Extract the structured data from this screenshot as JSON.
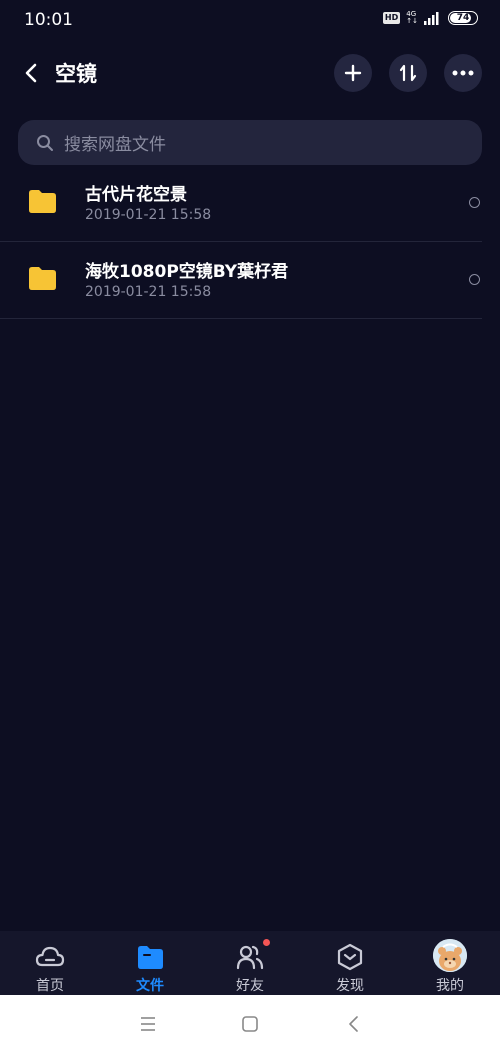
{
  "status_bar": {
    "time": "10:01",
    "hd": "HD",
    "network_top": "4G",
    "network_bottom": "↑↓",
    "battery": "74"
  },
  "header": {
    "title": "空镜",
    "buttons": [
      "back-icon",
      "plus-icon",
      "sort-icon",
      "more-icon"
    ]
  },
  "search": {
    "placeholder": "搜索网盘文件"
  },
  "files": [
    {
      "name": "古代片花空景",
      "date": "2019-01-21  15:58",
      "icon": "folder-icon"
    },
    {
      "name": "海牧1080P空镜BY葉杍君",
      "date": "2019-01-21  15:58",
      "icon": "folder-icon"
    }
  ],
  "tabs": [
    {
      "label": "首页",
      "icon": "home-cloud-icon",
      "active": false
    },
    {
      "label": "文件",
      "icon": "folder-icon",
      "active": true
    },
    {
      "label": "好友",
      "icon": "friends-icon",
      "active": false,
      "badge": true
    },
    {
      "label": "发现",
      "icon": "discover-icon",
      "active": false
    },
    {
      "label": "我的",
      "icon": "avatar",
      "active": false
    }
  ],
  "colors": {
    "background": "#0d0e22",
    "accent": "#1e8bff",
    "folder": "#f7c435",
    "badge": "#f35555"
  },
  "system_nav": [
    "menu-icon",
    "home-icon",
    "back-icon"
  ]
}
